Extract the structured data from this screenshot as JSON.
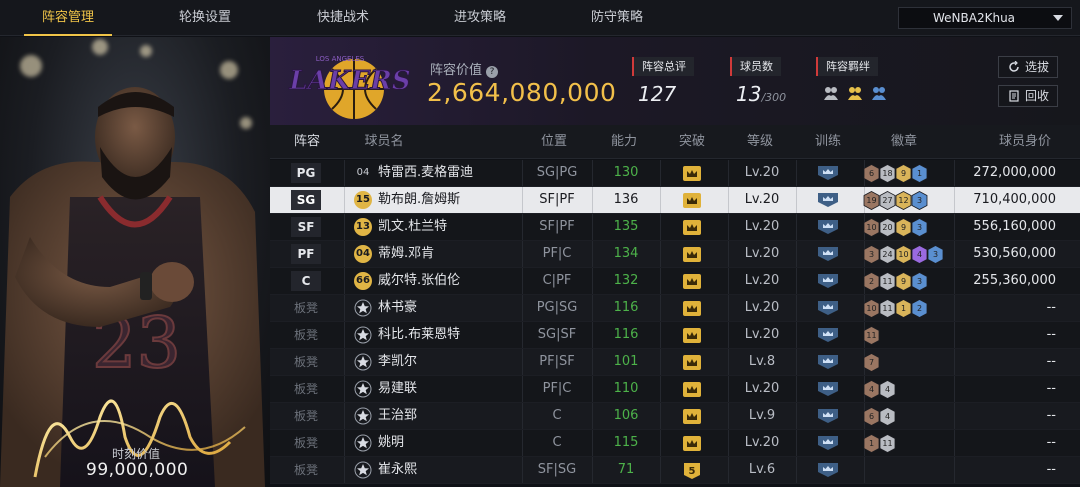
{
  "nav": {
    "tabs": [
      {
        "label": "阵容管理",
        "active": true
      },
      {
        "label": "轮换设置",
        "active": false
      },
      {
        "label": "快捷战术",
        "active": false
      },
      {
        "label": "进攻策略",
        "active": false
      },
      {
        "label": "防守策略",
        "active": false
      }
    ],
    "account": "WeNBA2Khua"
  },
  "hero": {
    "value_label": "时刻价值",
    "value": "99,000,000"
  },
  "team": {
    "logo_text": "LAKERS",
    "logo_subtext": "LOS ANGELES",
    "value_label": "阵容价值",
    "value": "2,664,080,000",
    "overall_label": "阵容总评",
    "overall": "127",
    "players_label": "球员数",
    "players_count": "13",
    "players_max": "/300",
    "bonds_label": "阵容羁绊",
    "bond_icons": [
      "bond-icon-1",
      "bond-icon-2",
      "bond-icon-3"
    ],
    "select_label": "选拔",
    "recycle_label": "回收"
  },
  "table": {
    "headers": [
      "阵容",
      "球员名",
      "位置",
      "能力",
      "突破",
      "等级",
      "训练",
      "徽章",
      "球员身价"
    ],
    "rows": [
      {
        "slot": "PG",
        "number": "04",
        "number_style": "plain",
        "name": "特雷西.麦格雷迪",
        "position": "SG|PG",
        "rating": "130",
        "breakthrough": "crown",
        "level": "Lv.20",
        "badges": [
          {
            "n": "6",
            "c": "bronze"
          },
          {
            "n": "18",
            "c": "silver"
          },
          {
            "n": "9",
            "c": "gold"
          },
          {
            "n": "1",
            "c": "blue"
          }
        ],
        "value": "272,000,000"
      },
      {
        "slot": "SG",
        "number": "15",
        "number_style": "gold",
        "name": "勒布朗.詹姆斯",
        "position": "SF|PF",
        "rating": "136",
        "breakthrough": "crown",
        "level": "Lv.20",
        "badges": [
          {
            "n": "19",
            "c": "bronze"
          },
          {
            "n": "27",
            "c": "silver"
          },
          {
            "n": "12",
            "c": "gold"
          },
          {
            "n": "3",
            "c": "blue"
          }
        ],
        "value": "710,400,000",
        "selected": true
      },
      {
        "slot": "SF",
        "number": "13",
        "number_style": "gold",
        "name": "凯文.杜兰特",
        "position": "SF|PF",
        "rating": "135",
        "breakthrough": "crown",
        "level": "Lv.20",
        "badges": [
          {
            "n": "10",
            "c": "bronze"
          },
          {
            "n": "20",
            "c": "silver"
          },
          {
            "n": "9",
            "c": "gold"
          },
          {
            "n": "3",
            "c": "blue"
          }
        ],
        "value": "556,160,000"
      },
      {
        "slot": "PF",
        "number": "04",
        "number_style": "gold",
        "name": "蒂姆.邓肯",
        "position": "PF|C",
        "rating": "134",
        "breakthrough": "crown",
        "level": "Lv.20",
        "badges": [
          {
            "n": "3",
            "c": "bronze"
          },
          {
            "n": "24",
            "c": "silver"
          },
          {
            "n": "10",
            "c": "gold"
          },
          {
            "n": "4",
            "c": "purple"
          },
          {
            "n": "3",
            "c": "blue"
          }
        ],
        "value": "530,560,000"
      },
      {
        "slot": "C",
        "number": "66",
        "number_style": "gold",
        "name": "威尔特.张伯伦",
        "position": "C|PF",
        "rating": "132",
        "breakthrough": "crown",
        "level": "Lv.20",
        "badges": [
          {
            "n": "2",
            "c": "bronze"
          },
          {
            "n": "11",
            "c": "silver"
          },
          {
            "n": "9",
            "c": "gold"
          },
          {
            "n": "3",
            "c": "blue"
          }
        ],
        "value": "255,360,000"
      },
      {
        "slot": "板凳",
        "number": "",
        "number_style": "star",
        "name": "林书豪",
        "position": "PG|SG",
        "rating": "116",
        "breakthrough": "crown",
        "level": "Lv.20",
        "badges": [
          {
            "n": "10",
            "c": "bronze"
          },
          {
            "n": "11",
            "c": "silver"
          },
          {
            "n": "1",
            "c": "gold"
          },
          {
            "n": "2",
            "c": "blue"
          }
        ],
        "value": "--"
      },
      {
        "slot": "板凳",
        "number": "",
        "number_style": "star",
        "name": "科比.布莱恩特",
        "position": "SG|SF",
        "rating": "116",
        "breakthrough": "crown",
        "level": "Lv.20",
        "badges": [
          {
            "n": "11",
            "c": "bronze"
          }
        ],
        "value": "--"
      },
      {
        "slot": "板凳",
        "number": "",
        "number_style": "star",
        "name": "李凯尔",
        "position": "PF|SF",
        "rating": "101",
        "breakthrough": "crown",
        "level": "Lv.8",
        "badges": [
          {
            "n": "7",
            "c": "bronze"
          }
        ],
        "value": "--"
      },
      {
        "slot": "板凳",
        "number": "",
        "number_style": "star",
        "name": "易建联",
        "position": "PF|C",
        "rating": "110",
        "breakthrough": "crown",
        "level": "Lv.20",
        "badges": [
          {
            "n": "4",
            "c": "bronze"
          },
          {
            "n": "4",
            "c": "silver"
          }
        ],
        "value": "--"
      },
      {
        "slot": "板凳",
        "number": "",
        "number_style": "star",
        "name": "王治郅",
        "position": "C",
        "rating": "106",
        "breakthrough": "crown",
        "level": "Lv.9",
        "badges": [
          {
            "n": "6",
            "c": "bronze"
          },
          {
            "n": "4",
            "c": "silver"
          }
        ],
        "value": "--"
      },
      {
        "slot": "板凳",
        "number": "",
        "number_style": "star",
        "name": "姚明",
        "position": "C",
        "rating": "115",
        "breakthrough": "crown",
        "level": "Lv.20",
        "badges": [
          {
            "n": "1",
            "c": "bronze"
          },
          {
            "n": "11",
            "c": "silver"
          }
        ],
        "value": "--"
      },
      {
        "slot": "板凳",
        "number": "",
        "number_style": "star",
        "name": "崔永熙",
        "position": "SF|SG",
        "rating": "71",
        "breakthrough": "5",
        "level": "Lv.6",
        "badges": [],
        "value": "--"
      }
    ]
  },
  "colors": {
    "accent": "#f0c448",
    "rating_green": "#4db24a",
    "badge_bronze": "#9a7662",
    "badge_silver": "#b9bcc2",
    "badge_gold": "#d9b45a",
    "badge_blue": "#5a8fd0",
    "badge_purple": "#9a6ae0"
  }
}
